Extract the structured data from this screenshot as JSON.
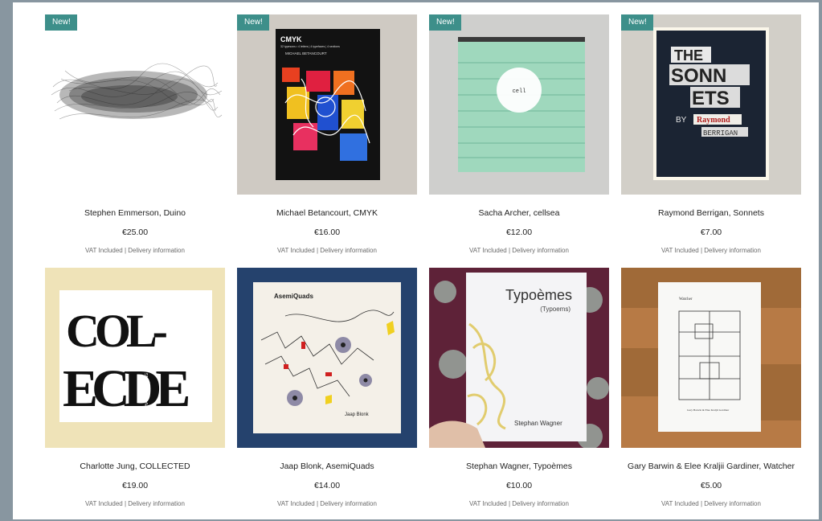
{
  "colors": {
    "badge": "#3d8f8a",
    "frame": "#8896a0"
  },
  "products": [
    {
      "title": "Stephen Emmerson, Duino",
      "price": "€25.00",
      "badge": "New!",
      "vat": "VAT Included",
      "delivery": "Delivery information",
      "cover": "scribble-cover"
    },
    {
      "title": "Michael Betancourt, CMYK",
      "price": "€16.00",
      "badge": "New!",
      "vat": "VAT Included",
      "delivery": "Delivery information",
      "cover": "cmyk-cover",
      "cover_text": {
        "title": "CMYK",
        "subtitle": "32 typesons • 4 letters | 4 typefaces | 4 sections",
        "author": "MICHAEL BETANCOURT"
      }
    },
    {
      "title": "Sacha Archer, cellsea",
      "price": "€12.00",
      "badge": "New!",
      "vat": "VAT Included",
      "delivery": "Delivery information",
      "cover": "sea-cover",
      "cover_text": {
        "word": "cell"
      }
    },
    {
      "title": "Raymond Berrigan, Sonnets",
      "price": "€7.00",
      "badge": "New!",
      "vat": "VAT Included",
      "delivery": "Delivery information",
      "cover": "sonnets-cover",
      "cover_text": {
        "line1": "THE",
        "line2": "SONN",
        "line3": "ETS",
        "by": "BY",
        "name1": "Raymond",
        "name2": "BERRIGAN"
      }
    },
    {
      "title": "Charlotte Jung, COLLECTED",
      "price": "€19.00",
      "vat": "VAT Included",
      "delivery": "Delivery information",
      "cover": "collected-cover",
      "cover_text": {
        "top": "COL-",
        "bottom": "ECDE",
        "author": "CHARLOTTE JUNG"
      }
    },
    {
      "title": "Jaap Blonk, AsemiQuads",
      "price": "€14.00",
      "vat": "VAT Included",
      "delivery": "Delivery information",
      "cover": "asemiquads-cover",
      "cover_text": {
        "title": "AsemiQuads",
        "author": "Jaap Blonk"
      }
    },
    {
      "title": "Stephan Wagner, Typoèmes",
      "price": "€10.00",
      "vat": "VAT Included",
      "delivery": "Delivery information",
      "cover": "typoemes-cover",
      "cover_text": {
        "title": "Typoèmes",
        "subtitle": "(Typoems)",
        "author": "Stephan Wagner"
      }
    },
    {
      "title": "Gary Barwin & Elee Kraljii Gardiner, Watcher",
      "price": "€5.00",
      "vat": "VAT Included",
      "delivery": "Delivery information",
      "cover": "watcher-cover",
      "cover_text": {
        "title": "Watcher",
        "author": "Gary Barwin & Elee Kraljii Gardiner"
      }
    }
  ]
}
